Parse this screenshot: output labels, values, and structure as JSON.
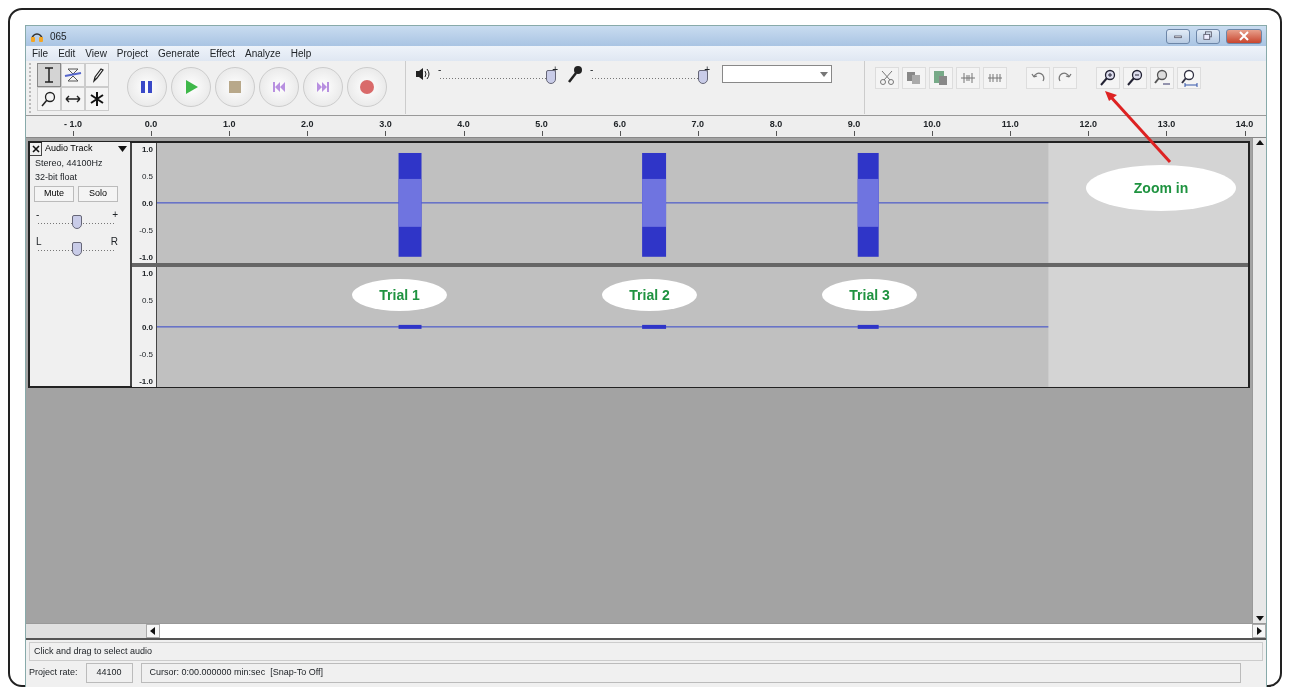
{
  "window": {
    "title": "065"
  },
  "menu": [
    {
      "label": "File"
    },
    {
      "label": "Edit"
    },
    {
      "label": "View"
    },
    {
      "label": "Project"
    },
    {
      "label": "Generate"
    },
    {
      "label": "Effect"
    },
    {
      "label": "Analyze"
    },
    {
      "label": "Help"
    }
  ],
  "tools": [
    {
      "kind": "ibeam",
      "selected": true
    },
    {
      "kind": "envelope",
      "selected": false
    },
    {
      "kind": "pencil",
      "selected": false
    },
    {
      "kind": "zoom",
      "selected": false
    },
    {
      "kind": "timeshift",
      "selected": false
    },
    {
      "kind": "multi",
      "selected": false
    }
  ],
  "transport": [
    {
      "kind": "pause"
    },
    {
      "kind": "play"
    },
    {
      "kind": "stop"
    },
    {
      "kind": "skip_start"
    },
    {
      "kind": "skip_end"
    },
    {
      "kind": "record"
    }
  ],
  "meters": [
    {
      "kind": "speaker",
      "min_label": "-",
      "max_label": "+",
      "level": 1.0
    },
    {
      "kind": "microphone",
      "min_label": "-",
      "max_label": "+",
      "level": 1.0
    }
  ],
  "device_select": {
    "kind": "dropdown"
  },
  "edit_tools": [
    {
      "kind": "cut"
    },
    {
      "kind": "copy"
    },
    {
      "kind": "paste"
    },
    {
      "kind": "trim"
    },
    {
      "kind": "silence"
    },
    {
      "kind": "undo"
    },
    {
      "kind": "redo"
    },
    {
      "kind": "zoom_in"
    },
    {
      "kind": "zoom_out"
    },
    {
      "kind": "fit_selection"
    },
    {
      "kind": "fit_project"
    }
  ],
  "ruler": {
    "ticks": [
      "- 1.0",
      "0.0",
      "1.0",
      "2.0",
      "3.0",
      "4.0",
      "5.0",
      "6.0",
      "7.0",
      "8.0",
      "9.0",
      "10.0",
      "11.0",
      "12.0",
      "13.0",
      "14.0"
    ]
  },
  "track": {
    "name": "Audio Track",
    "info": [
      "Stereo, 44100Hz",
      "32-bit float"
    ],
    "buttons": [
      {
        "label": "Mute",
        "on": false
      },
      {
        "label": "Solo",
        "on": false
      }
    ],
    "gain": {
      "min_label": "-",
      "max_label": "+",
      "level": 0.5
    },
    "pan": {
      "min_label": "L",
      "max_label": "R",
      "level": 0.5
    },
    "channels": [
      {
        "scale": [
          "1.0",
          "0.5",
          "0.0",
          "-0.5",
          "-1.0"
        ]
      },
      {
        "scale": [
          "1.0",
          "0.5",
          "0.0",
          "-0.5",
          "-1.0"
        ]
      }
    ]
  },
  "annotations": [
    {
      "kind": "label",
      "text": "Trial 1"
    },
    {
      "kind": "label",
      "text": "Trial 2"
    },
    {
      "kind": "label",
      "text": "Trial 3"
    },
    {
      "kind": "callout",
      "text": "Zoom in"
    }
  ],
  "status": {
    "message": "Click and drag to select audio",
    "rate_label": "Project rate:",
    "rate": "44100",
    "cursor": "Cursor: 0:00.000000 min:sec  [Snap-To Off]"
  }
}
